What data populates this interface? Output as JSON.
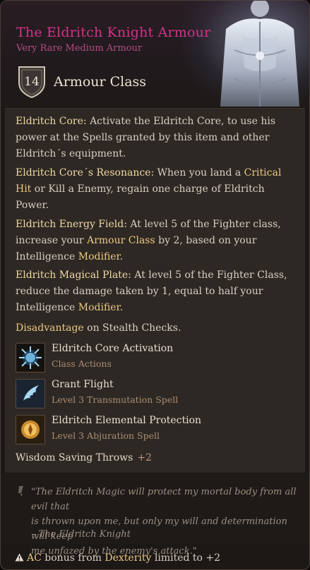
{
  "item": {
    "title": "The Eldritch Knight Armour",
    "rarity_type": "Very Rare Medium Armour",
    "armour_class_value": "14",
    "armour_class_label": "Armour Class"
  },
  "description": [
    {
      "heading": "Eldritch Core:",
      "lines": [
        "Activate the Eldritch Core, to use his",
        "power at the Spells granted by this item and other",
        "Eldritch´s equipment."
      ]
    },
    {
      "heading": "Eldritch Core´s Resonance:",
      "line1_text": "When you land a",
      "line1_kw": "Critical",
      "line2_kw": "Hit",
      "line2_text": "or Kill a Enemy, regain one charge of Eldritch",
      "line3_text": "Power."
    },
    {
      "heading": "Eldritch Energy Field:",
      "line1_text": "At level 5 of the Fighter class,",
      "line2_pre": "increase your",
      "line2_kw": "Armour Class",
      "line2_post": "by 2, based on your",
      "line3_pre": "Intelligence",
      "line3_kw": "Modifier",
      "line3_post": "."
    },
    {
      "heading": "Eldritch Magical Plate:",
      "line1_text": "At level 5 of the Fighter Class,",
      "line2_text": "reduce the damage taken by 1, equal to half your",
      "line3_pre": "Intelligence",
      "line3_kw": "Modifier",
      "line3_post": "."
    }
  ],
  "disadvantage": {
    "kw": "Disadvantage",
    "text": "on Stealth Checks",
    "end": "."
  },
  "spells": [
    {
      "name": "Eldritch Core Activation",
      "sub": "Class Actions",
      "icon": "eldritch-core-icon"
    },
    {
      "name": "Grant Flight",
      "sub": "Level 3 Transmutation Spell",
      "icon": "wing-icon"
    },
    {
      "name": "Eldritch Elemental Protection",
      "sub": "Level 3 Abjuration Spell",
      "icon": "elemental-shield-icon"
    }
  ],
  "saving_throw": {
    "label": "Wisdom Saving Throws",
    "bonus": "+2"
  },
  "flavor": {
    "lines": [
      "\"The Eldritch Magic will protect my mortal body from all evil that",
      "is thrown upon me, but only my will and determination will keep",
      "me unfazed by the enemy's attack.\""
    ],
    "author": "- The Eldritch Knight"
  },
  "footer": {
    "kw1": "AC",
    "text1": "bonus from",
    "kw2": "Dexterity",
    "text2": "limited to +2"
  },
  "colors": {
    "title": "#d0358a",
    "subtitle": "#b34d84",
    "keyword": "#e9c983",
    "body_text": "#d8cfc2"
  }
}
